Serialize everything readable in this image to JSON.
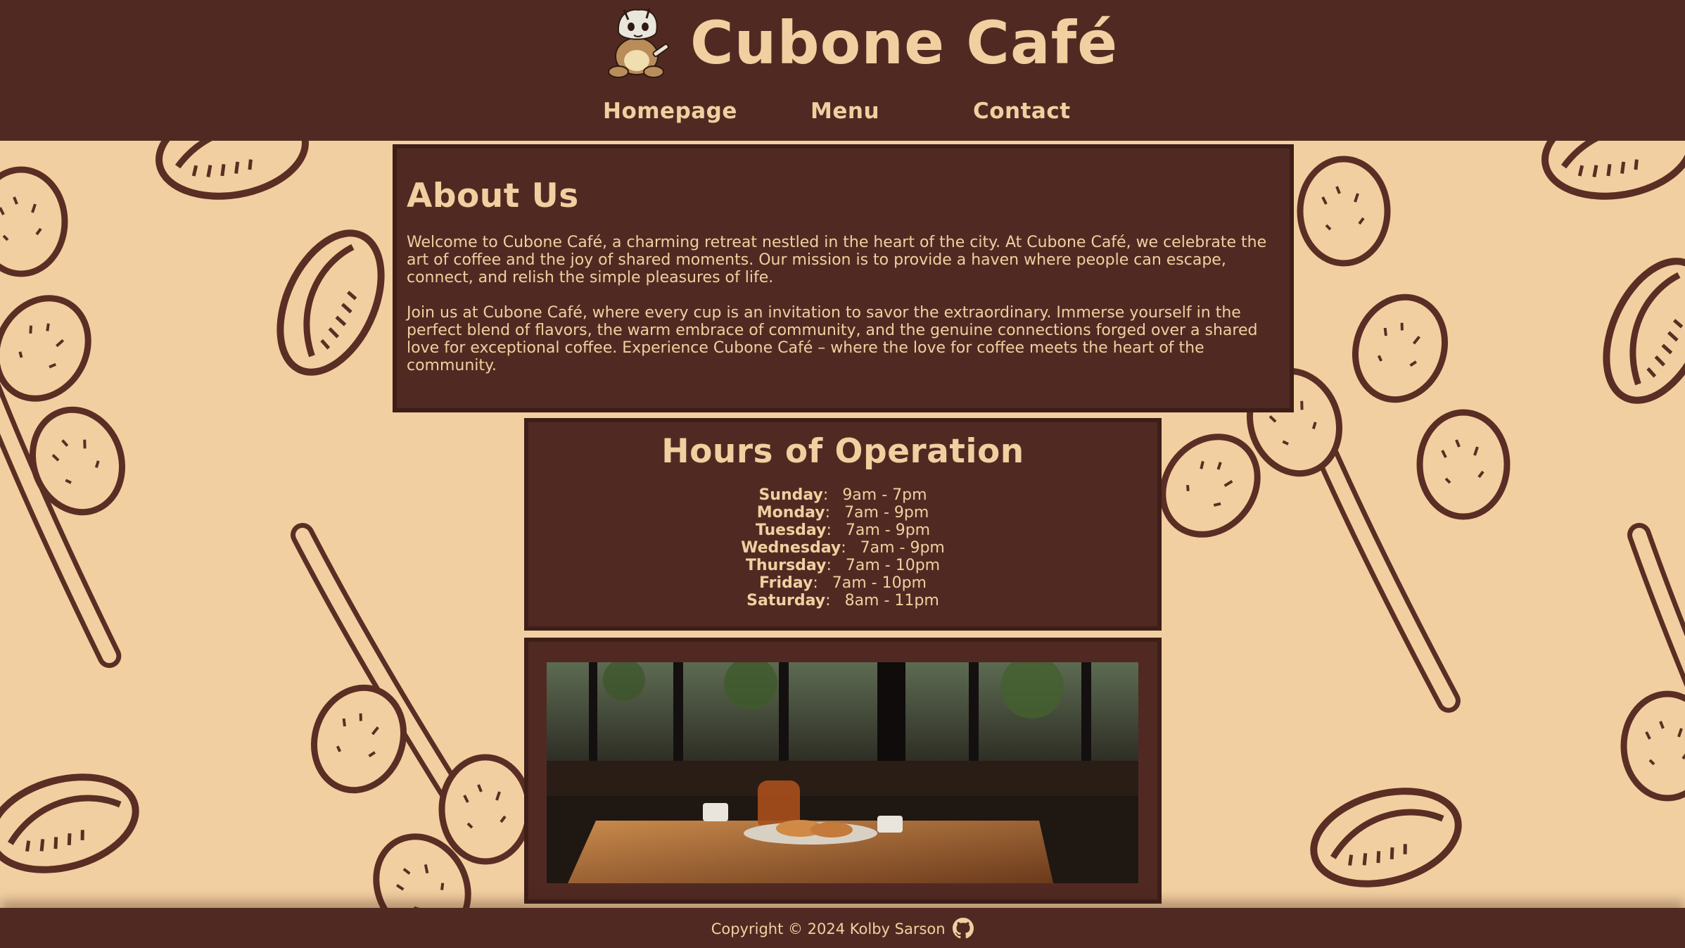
{
  "header": {
    "title": "Cubone Café",
    "logo_icon": "cubone-mascot-icon",
    "nav": [
      {
        "label": "Homepage"
      },
      {
        "label": "Menu"
      },
      {
        "label": "Contact"
      }
    ]
  },
  "about": {
    "heading": "About Us",
    "paragraphs": [
      "Welcome to Cubone Café, a charming retreat nestled in the heart of the city. At Cubone Café, we celebrate the art of coffee and the joy of shared moments. Our mission is to provide a haven where people can escape, connect, and relish the simple pleasures of life.",
      "Join us at Cubone Café, where every cup is an invitation to savor the extraordinary. Immerse yourself in the perfect blend of flavors, the warm embrace of community, and the genuine connections forged over a shared love for exceptional coffee. Experience Cubone Café – where the love for coffee meets the heart of the community."
    ]
  },
  "hours": {
    "heading": "Hours of Operation",
    "rows": [
      {
        "day": "Sunday",
        "time": "9am - 7pm"
      },
      {
        "day": "Monday",
        "time": "7am - 9pm"
      },
      {
        "day": "Tuesday",
        "time": "7am - 9pm"
      },
      {
        "day": "Wednesday",
        "time": "7am - 9pm"
      },
      {
        "day": "Thursday",
        "time": "7am - 10pm"
      },
      {
        "day": "Friday",
        "time": "7am - 10pm"
      },
      {
        "day": "Saturday",
        "time": "8am - 11pm"
      }
    ]
  },
  "footer": {
    "copyright": "Copyright © 2024 Kolby Sarson",
    "icon": "github-icon"
  },
  "colors": {
    "brown": "#502a22",
    "cream": "#f2cfa0",
    "border": "#3d1e18"
  }
}
